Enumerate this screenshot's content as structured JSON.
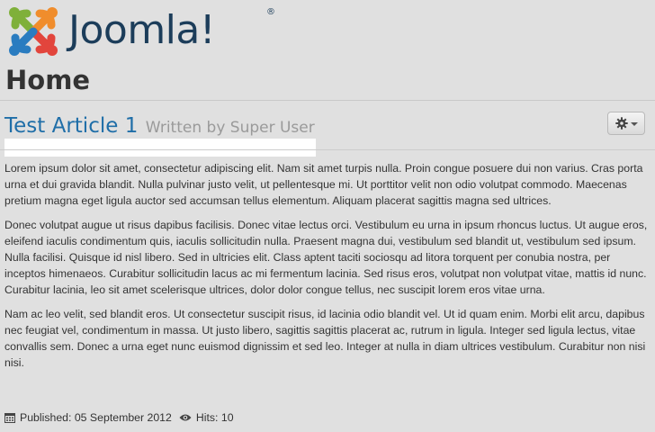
{
  "header": {
    "logo_text": "Joomla!",
    "logo_reg": "®",
    "page_title": "Home"
  },
  "article": {
    "title": "Test Article 1",
    "byline": "Written by Super User",
    "tools_icon": "gear-icon",
    "paragraphs": [
      "Lorem ipsum dolor sit amet, consectetur adipiscing elit. Nam sit amet turpis nulla. Proin congue posuere dui non varius. Cras porta urna et dui gravida blandit. Nulla pulvinar justo velit, ut pellentesque mi. Ut porttitor velit non odio volutpat commodo. Maecenas pretium magna eget ligula auctor sed accumsan tellus elementum. Aliquam placerat sagittis magna sed ultrices.",
      "Donec volutpat augue ut risus dapibus facilisis. Donec vitae lectus orci. Vestibulum eu urna in ipsum rhoncus luctus. Ut augue eros, eleifend iaculis condimentum quis, iaculis sollicitudin nulla. Praesent magna dui, vestibulum sed blandit ut, vestibulum sed ipsum. Nulla facilisi. Quisque id nisl libero. Sed in ultricies elit. Class aptent taciti sociosqu ad litora torquent per conubia nostra, per inceptos himenaeos. Curabitur sollicitudin lacus ac mi fermentum lacinia. Sed risus eros, volutpat non volutpat vitae, mattis id nunc. Curabitur lacinia, leo sit amet scelerisque ultrices, dolor dolor congue tellus, nec suscipit lorem eros vitae urna.",
      "Nam ac leo velit, sed blandit eros. Ut consectetur suscipit risus, id lacinia odio blandit vel. Ut id quam enim. Morbi elit arcu, dapibus nec feugiat vel, condimentum in massa. Ut justo libero, sagittis sagittis placerat ac, rutrum in ligula. Integer sed ligula lectus, vitae convallis sem. Donec a urna eget nunc euismod dignissim et sed leo. Integer at nulla in diam ultrices vestibulum. Curabitur non nisi nisi."
    ],
    "published": "Published: 05 September 2012",
    "hits": "Hits: 10"
  },
  "colors": {
    "background": "#e0e0e0",
    "title_blue": "#1f6ea8",
    "logo_navy": "#1c3d5a"
  }
}
